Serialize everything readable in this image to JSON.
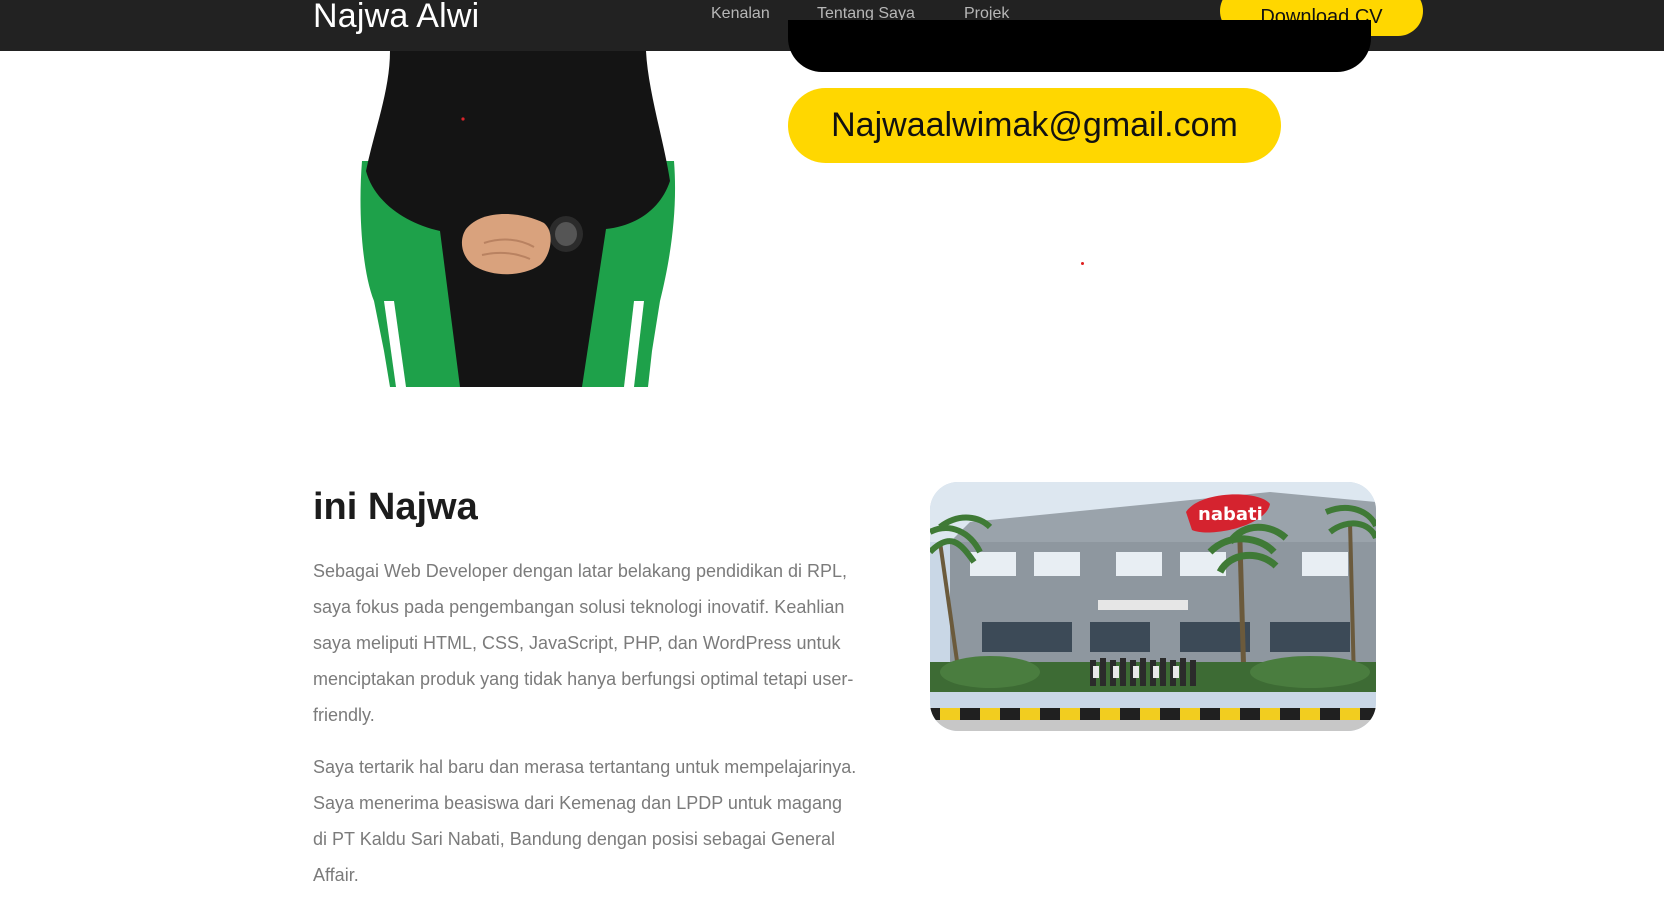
{
  "nav": {
    "brand": "Najwa Alwi",
    "links": [
      "Kenalan",
      "Tentang Saya",
      "Projek"
    ],
    "cta_label": "Download CV"
  },
  "hero": {
    "email": "Najwaalwimak@gmail.com"
  },
  "about": {
    "title": "ini Najwa",
    "paragraphs": [
      "Sebagai Web Developer dengan latar belakang pendidikan di RPL, saya fokus pada pengembangan solusi teknologi inovatif. Keahlian saya meliputi HTML, CSS, JavaScript, PHP, dan WordPress untuk menciptakan produk yang tidak hanya berfungsi optimal tetapi user-friendly.",
      "Saya tertarik hal baru dan merasa tertantang untuk mempelajarinya. Saya menerima beasiswa dari Kemenag dan LPDP untuk magang di PT Kaldu Sari Nabati, Bandung dengan posisi sebagai General Affair."
    ],
    "photo_sign": "nabati"
  },
  "colors": {
    "nav_bg": "#222222",
    "accent_yellow": "#ffd700",
    "text_dark": "#1c1c1c",
    "text_muted": "#7b7b7b"
  }
}
